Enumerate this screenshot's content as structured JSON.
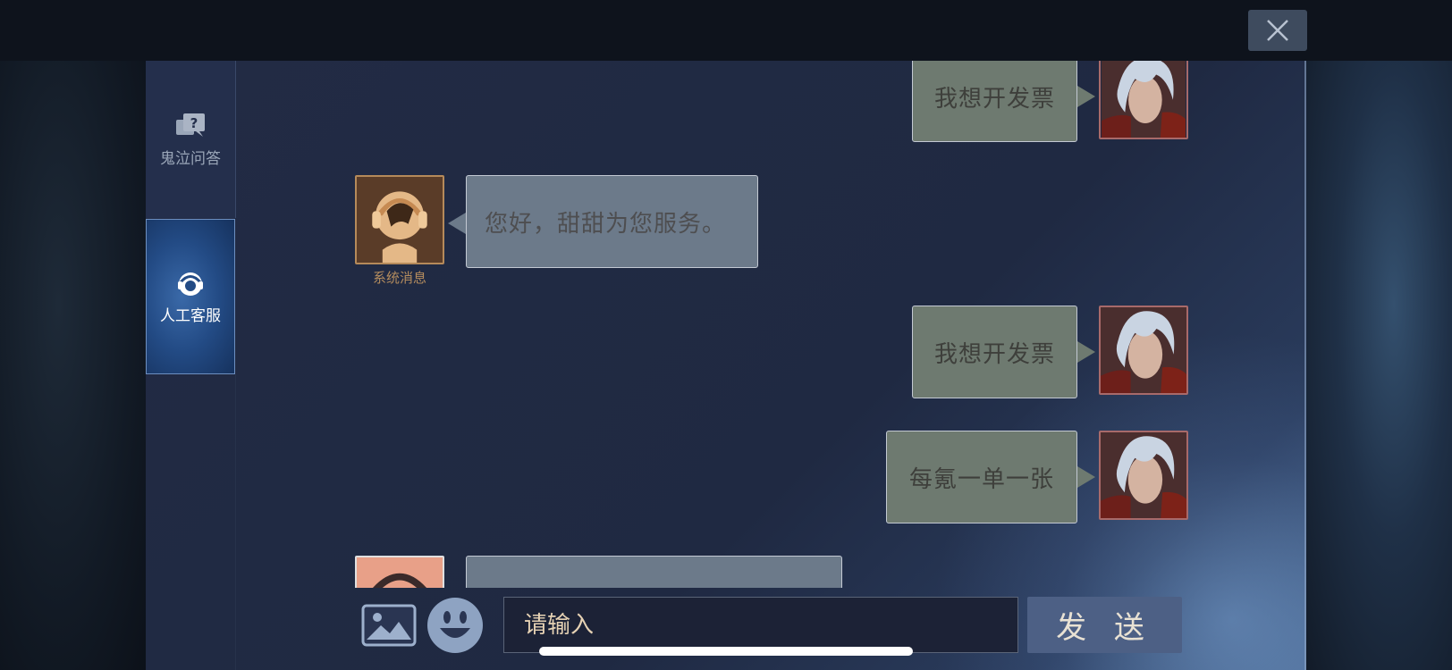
{
  "header": {
    "close_icon": "close-icon"
  },
  "sidebar": {
    "items": [
      {
        "label": "鬼泣问答",
        "icon": "question-chat-icon",
        "active": false
      },
      {
        "label": "人工客服",
        "icon": "headset-agent-icon",
        "active": true
      }
    ]
  },
  "chat": {
    "messages": [
      {
        "side": "right",
        "text": "我想开发票"
      },
      {
        "side": "left",
        "text": "您好，甜甜为您服务。",
        "caption": "系统消息"
      },
      {
        "side": "right",
        "text": "我想开发票"
      },
      {
        "side": "right",
        "text": "每氪一单一张"
      },
      {
        "side": "left",
        "text": ""
      }
    ]
  },
  "composer": {
    "image_icon": "image-icon",
    "emoji_icon": "emoji-icon",
    "placeholder": "请输入",
    "send_label": "发 送"
  },
  "colors": {
    "panel": "#222b44",
    "bubble_right": "#6e7a70",
    "bubble_left": "#6c7a8a",
    "send_button": "#4d6085",
    "caption": "#b48c5e"
  }
}
